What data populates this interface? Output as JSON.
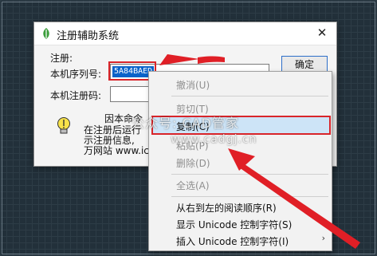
{
  "background": "cad-grid",
  "dialog": {
    "title": "注册辅助系统",
    "close_glyph": "✕",
    "group_label": "注册:",
    "serial_label": "本机序列号:",
    "serial_value": "5A84BAED",
    "regcode_label": "本机注册码:",
    "ok_label": "确定",
    "info_lines": [
      "因本命令",
      "在注册后运行",
      "示注册信息,",
      "万网站 www.icq"
    ]
  },
  "context_menu": {
    "items": [
      {
        "label": "撤消(U)",
        "enabled": false
      },
      {
        "label": "剪切(T)",
        "enabled": false
      },
      {
        "label": "复制(C)",
        "enabled": true,
        "highlighted": true
      },
      {
        "label": "粘贴(P)",
        "enabled": false
      },
      {
        "label": "删除(D)",
        "enabled": false
      },
      {
        "label": "全选(A)",
        "enabled": false
      },
      {
        "label": "从右到左的阅读顺序(R)",
        "enabled": true
      },
      {
        "label": "显示 Unicode 控制字符(S)",
        "enabled": true
      },
      {
        "label": "插入 Unicode 控制字符(I)",
        "enabled": true,
        "submenu": true
      }
    ],
    "submenu_glyph": "›"
  },
  "watermark": {
    "line1": "公众号: CAD管家",
    "line2": "www.cadgj.cn"
  },
  "colors": {
    "highlight_border": "#d9252a",
    "arrow": "#e01f26",
    "selection": "#0a63c9"
  }
}
